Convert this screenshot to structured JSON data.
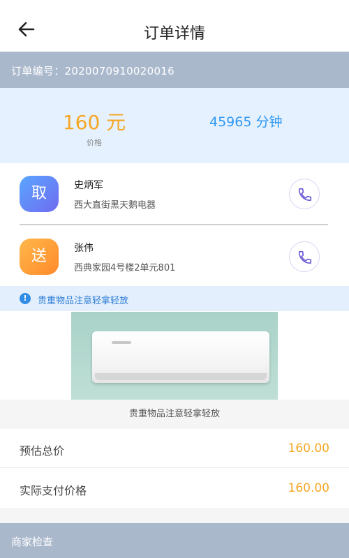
{
  "header": {
    "title": "订单详情",
    "back_icon": "arrow-left-icon"
  },
  "order": {
    "number_text": "订单编号：2020070910020016"
  },
  "summary": {
    "price_value": "160 元",
    "price_label": "价格",
    "duration": "45965 分钟",
    "price_color": "#f5a623",
    "duration_color": "#2f98f3"
  },
  "pickup": {
    "badge": "取",
    "name": "史炳军",
    "address": "西大直街黑天鹅电器",
    "call_icon": "phone-icon"
  },
  "delivery": {
    "badge": "送",
    "name": "张伟",
    "address": "西典家园4号楼2单元801",
    "call_icon": "phone-icon"
  },
  "notice": {
    "icon": "info-icon",
    "icon_glyph": "!",
    "text": "贵重物品注意轻拿轻放"
  },
  "item": {
    "image_name": "air-conditioner-image",
    "caption": "贵重物品注意轻拿轻放"
  },
  "pricing": {
    "estimated_label": "预估总价",
    "estimated_value": "160.00",
    "actual_label": "实际支付价格",
    "actual_value": "160.00"
  },
  "merchant": {
    "section_label": "商家检查"
  }
}
